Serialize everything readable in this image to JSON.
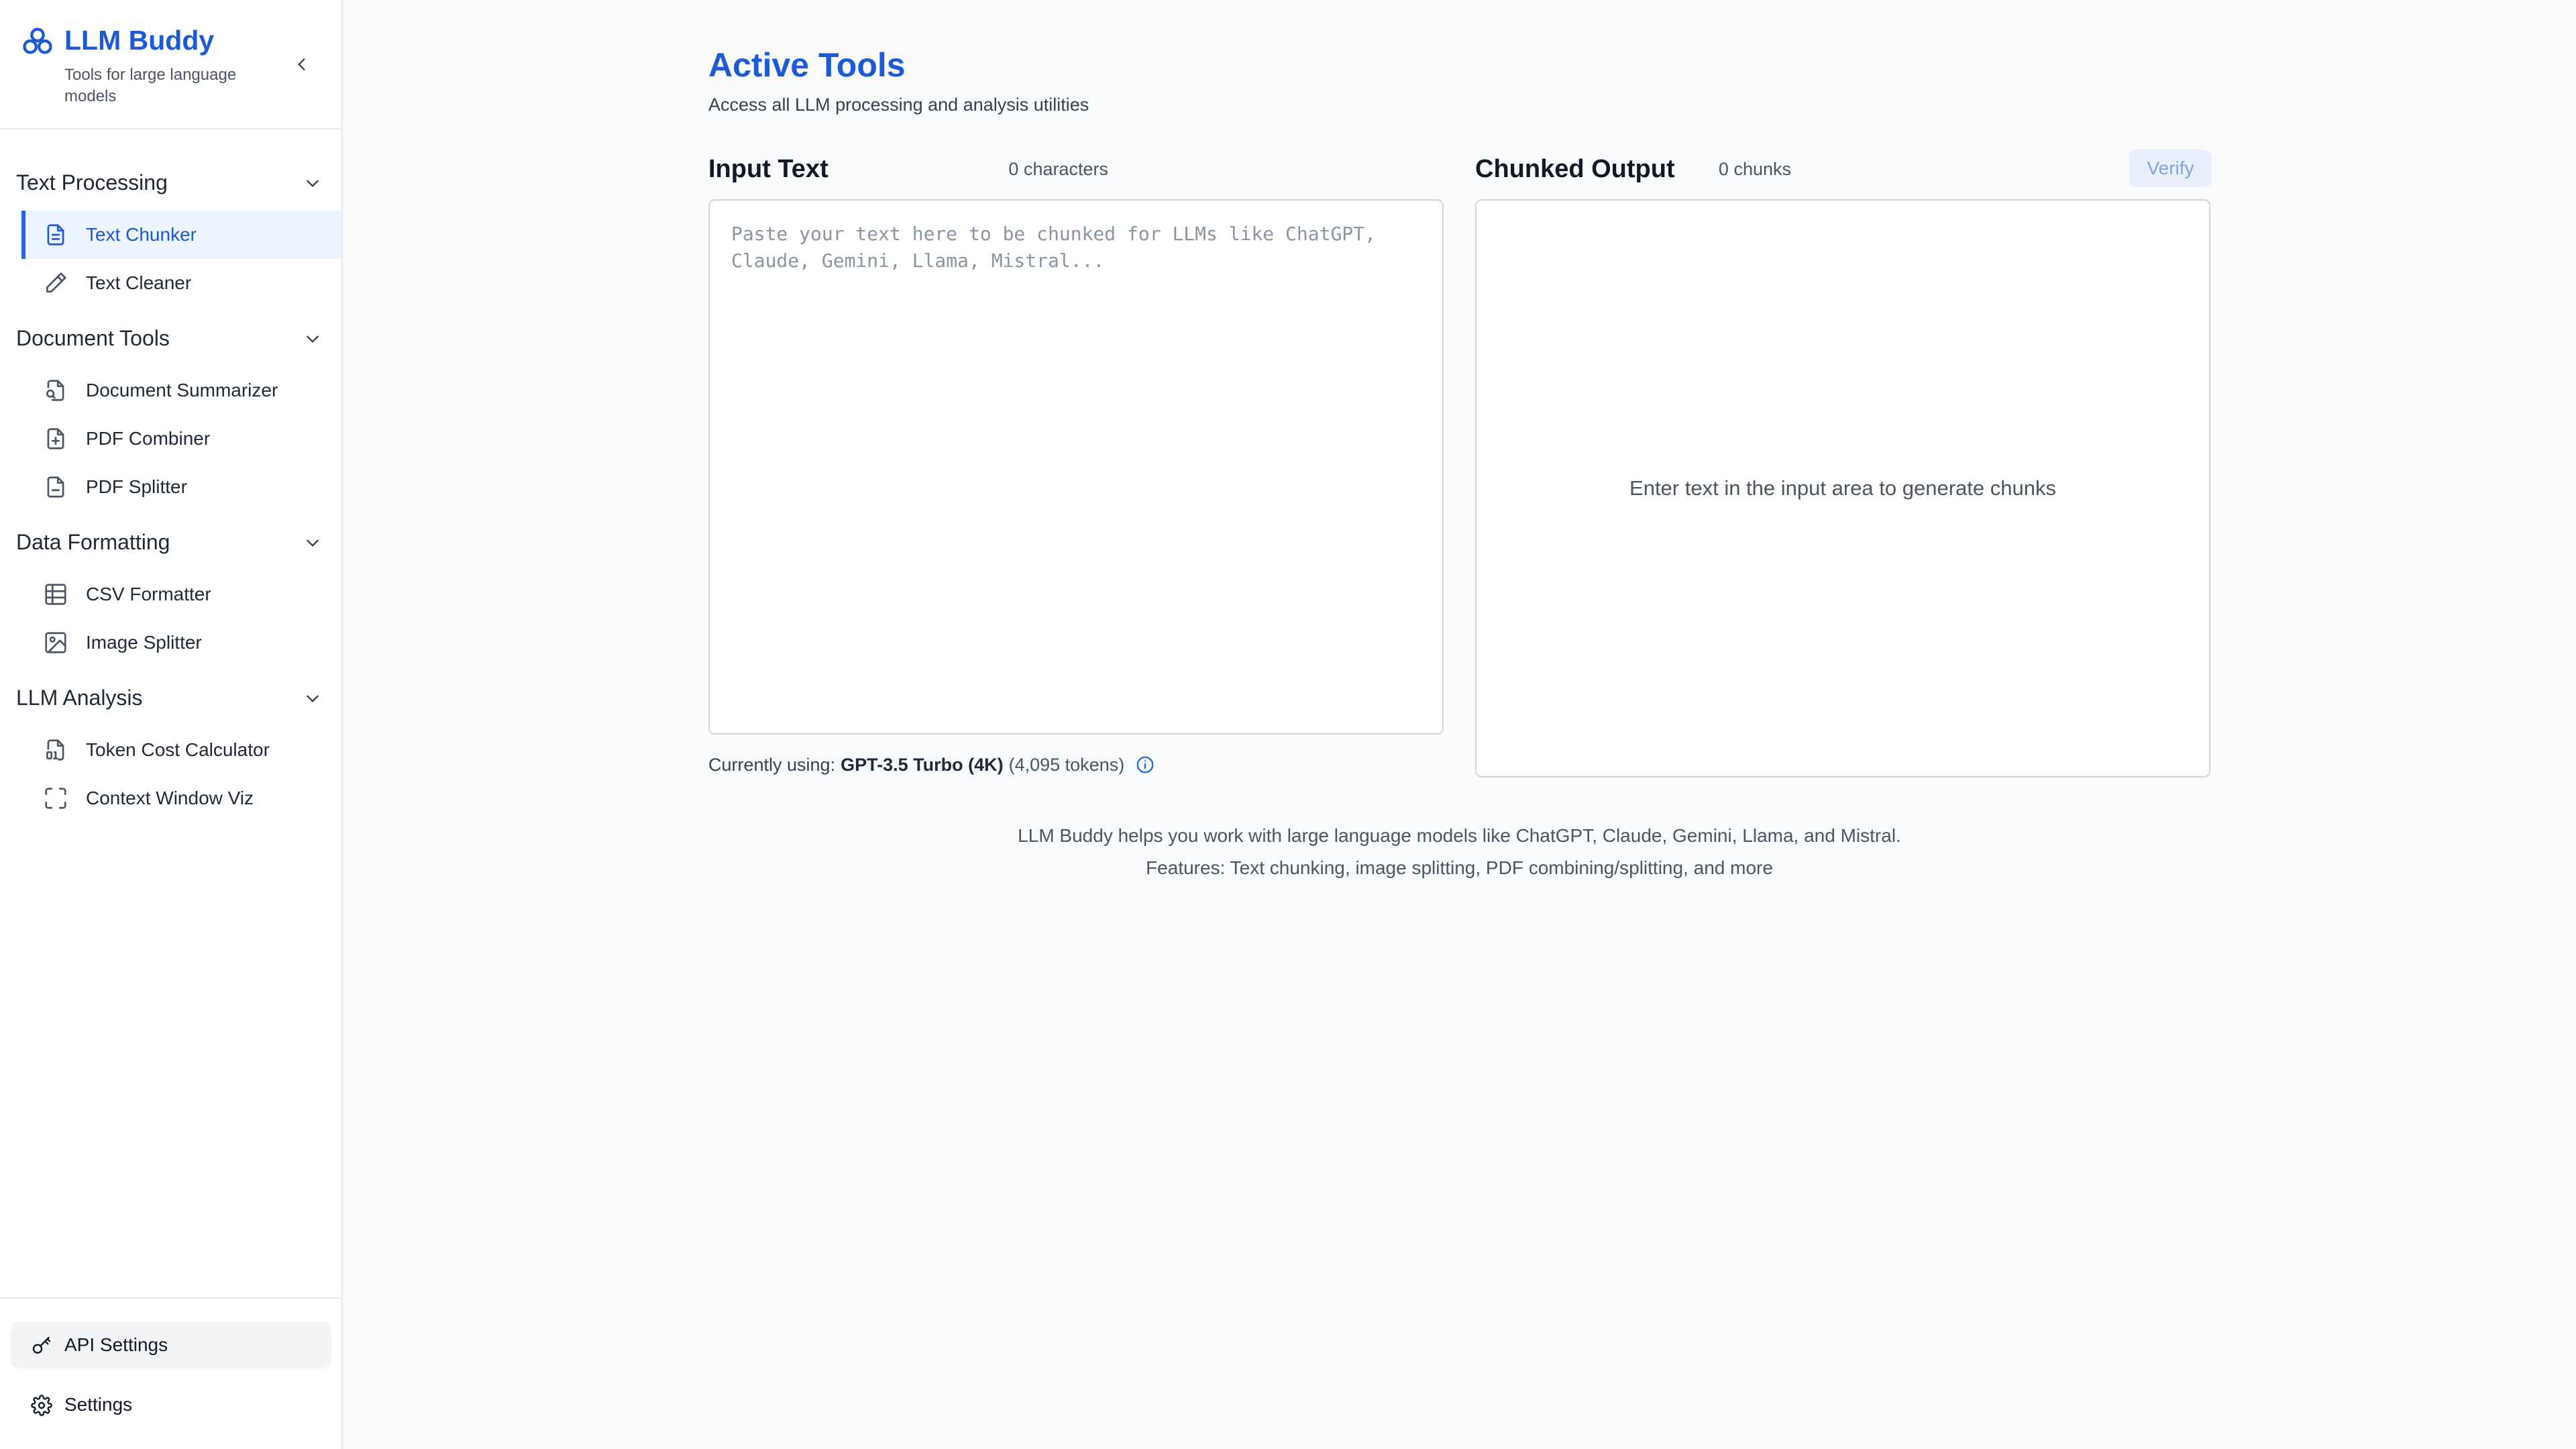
{
  "brand": {
    "title": "LLM Buddy",
    "subtitle": "Tools for large language models",
    "accent": "#1d5bd6"
  },
  "sidebar": {
    "groups": [
      {
        "label": "Text Processing",
        "items": [
          {
            "label": "Text Chunker",
            "icon": "document-icon",
            "active": true
          },
          {
            "label": "Text Cleaner",
            "icon": "pencil-icon",
            "active": false
          }
        ]
      },
      {
        "label": "Document Tools",
        "items": [
          {
            "label": "Document Summarizer",
            "icon": "file-search-icon",
            "active": false
          },
          {
            "label": "PDF Combiner",
            "icon": "file-plus-icon",
            "active": false
          },
          {
            "label": "PDF Splitter",
            "icon": "file-minus-icon",
            "active": false
          }
        ]
      },
      {
        "label": "Data Formatting",
        "items": [
          {
            "label": "CSV Formatter",
            "icon": "table-icon",
            "active": false
          },
          {
            "label": "Image Splitter",
            "icon": "image-icon",
            "active": false
          }
        ]
      },
      {
        "label": "LLM Analysis",
        "items": [
          {
            "label": "Token Cost Calculator",
            "icon": "file-digits-icon",
            "active": false
          },
          {
            "label": "Context Window Viz",
            "icon": "scan-frame-icon",
            "active": false
          }
        ]
      }
    ],
    "bottom": {
      "api_settings": "API Settings",
      "settings": "Settings"
    }
  },
  "main": {
    "title": "Active Tools",
    "subtitle": "Access all LLM processing and analysis utilities",
    "input": {
      "title": "Input Text",
      "count": "0 characters",
      "placeholder": "Paste your text here to be chunked for LLMs like ChatGPT, Claude, Gemini, Llama, Mistral...",
      "value": ""
    },
    "output": {
      "title": "Chunked Output",
      "count": "0 chunks",
      "verify_label": "Verify",
      "empty_message": "Enter text in the input area to generate chunks"
    },
    "model": {
      "prefix": "Currently using:",
      "name": "GPT-3.5 Turbo (4K)",
      "tokens": "(4,095 tokens)"
    },
    "footer": {
      "line1": "LLM Buddy helps you work with large language models like ChatGPT, Claude, Gemini, Llama, and Mistral.",
      "line2": "Features: Text chunking, image splitting, PDF combining/splitting, and more"
    }
  }
}
